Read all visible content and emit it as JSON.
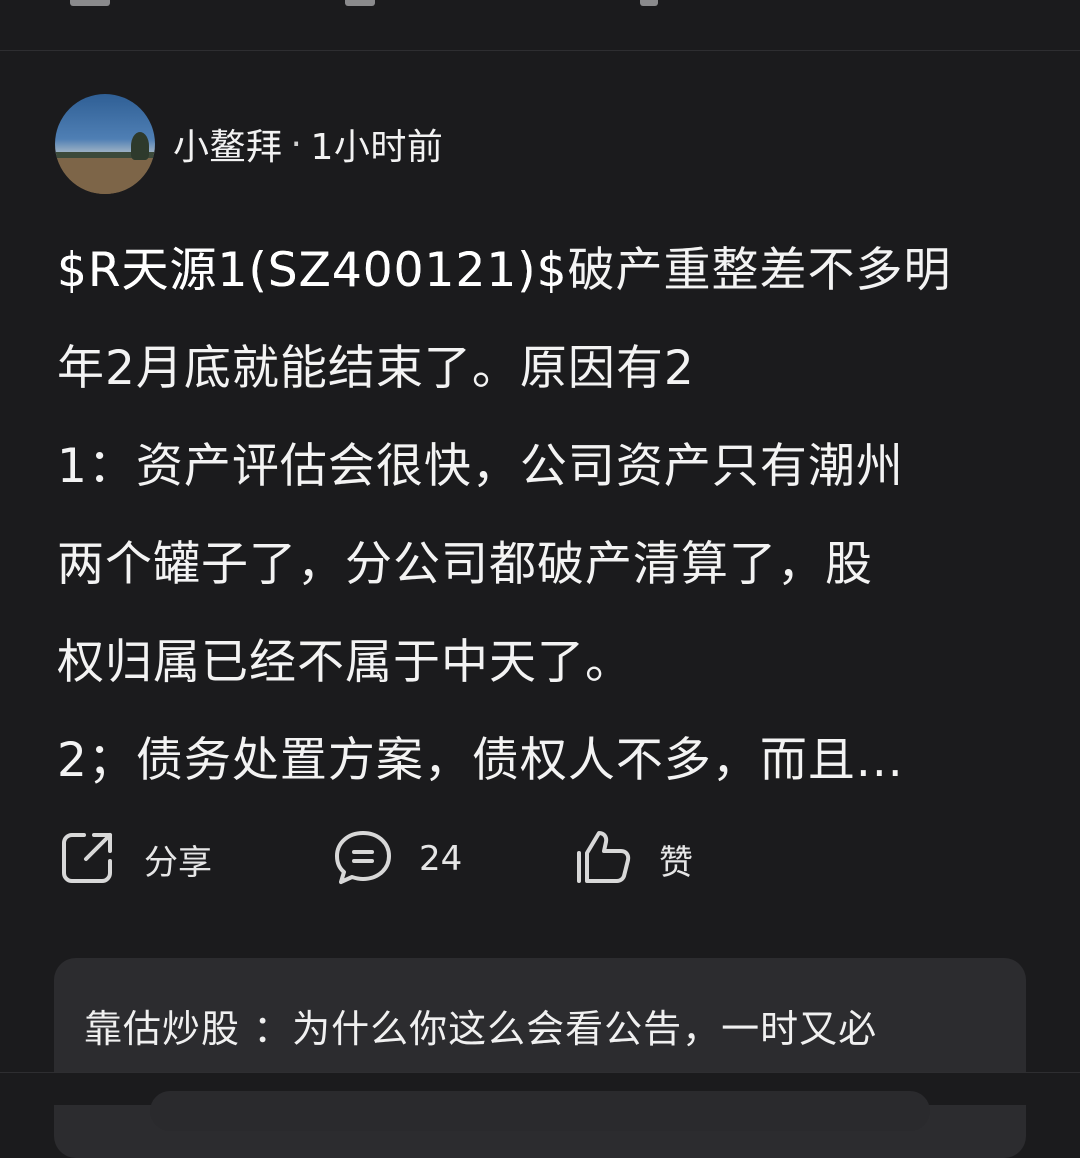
{
  "post": {
    "author": {
      "name": "小鳌拜",
      "separator": "·",
      "time": "1小时前"
    },
    "content": {
      "stock_tag": "$R天源1(SZ400121)$",
      "lines": [
        "破产重整差不多明",
        "年2月底就能结束了。原因有2",
        "1：资产评估会很快，公司资产只有潮州",
        "两个罐子了，分公司都破产清算了，股",
        "权归属已经不属于中天了。",
        "2；债务处置方案，债权人不多，而且..."
      ]
    },
    "actions": {
      "share_label": "分享",
      "comment_count": "24",
      "like_label": "赞"
    },
    "reply_preview": {
      "text": "靠估炒股 ：为什么你这么会看公告，一时又必"
    }
  },
  "colors": {
    "background": "#1b1b1d",
    "reply_background": "#2c2c2f",
    "text": "#f2f2f2"
  },
  "icons": [
    "share-icon",
    "comment-icon",
    "like-icon"
  ]
}
